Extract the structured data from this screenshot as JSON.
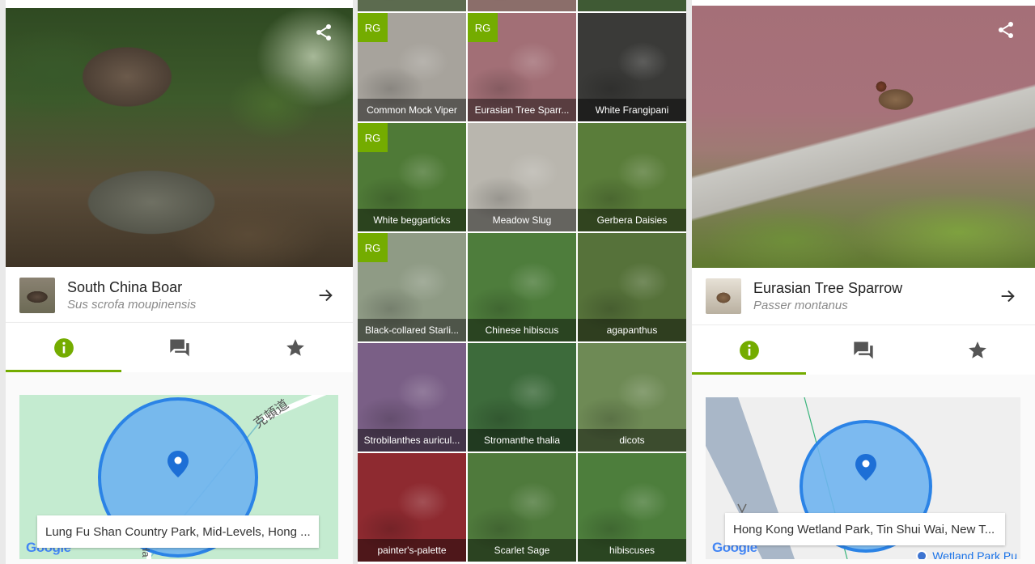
{
  "colors": {
    "accent": "#74ac00",
    "rg_badge": "#74ac00",
    "map_circle": "#6fb4f0",
    "map_circle_border": "#2b83e6"
  },
  "icons": {
    "share": "share-icon",
    "forward": "arrow-right-icon",
    "info": "info-icon",
    "comments": "comment-icon",
    "favorite": "star-icon",
    "pin": "map-pin-icon"
  },
  "left_panel": {
    "common_name": "South China Boar",
    "scientific_name": "Sus scrofa moupinensis",
    "tabs": [
      "info",
      "comments",
      "favorites"
    ],
    "active_tab": 0,
    "location": "Lung Fu Shan Country Park, Mid-Levels, Hong ...",
    "map_label_cn": "克頓道",
    "map_label_v": "Ha",
    "map_brand": "Google"
  },
  "right_panel": {
    "common_name": "Eurasian Tree Sparrow",
    "scientific_name": "Passer montanus",
    "tabs": [
      "info",
      "comments",
      "favorites"
    ],
    "active_tab": 0,
    "location": "Hong Kong Wetland Park, Tin Shui Wai, New T...",
    "map_place_label": "Wetland Park Pu",
    "map_brand": "Google"
  },
  "grid": {
    "rg_label": "RG",
    "items": [
      {
        "name": "",
        "rg": false,
        "bg": "#5c6b4f"
      },
      {
        "name": "",
        "rg": false,
        "bg": "#8b6e6a"
      },
      {
        "name": "",
        "rg": false,
        "bg": "#3f5a34"
      },
      {
        "name": "Common Mock Viper",
        "rg": true,
        "bg": "#a7a39c"
      },
      {
        "name": "Eurasian Tree Sparr...",
        "rg": true,
        "bg": "#a26f76"
      },
      {
        "name": "White Frangipani",
        "rg": false,
        "bg": "#3a3a38"
      },
      {
        "name": "White beggarticks",
        "rg": true,
        "bg": "#4f7a37"
      },
      {
        "name": "Meadow Slug",
        "rg": false,
        "bg": "#b9b6ae"
      },
      {
        "name": "Gerbera Daisies",
        "rg": false,
        "bg": "#5a7d3a"
      },
      {
        "name": "Black-collared Starli...",
        "rg": true,
        "bg": "#8f9b85"
      },
      {
        "name": "Chinese hibiscus",
        "rg": false,
        "bg": "#4e7d3c"
      },
      {
        "name": "agapanthus",
        "rg": false,
        "bg": "#56723a"
      },
      {
        "name": "Strobilanthes auricul...",
        "rg": false,
        "bg": "#7a5f86"
      },
      {
        "name": "Stromanthe thalia",
        "rg": false,
        "bg": "#3d6b3b"
      },
      {
        "name": "dicots",
        "rg": false,
        "bg": "#6e8a55"
      },
      {
        "name": "painter's-palette",
        "rg": false,
        "bg": "#8e2a30"
      },
      {
        "name": "Scarlet Sage",
        "rg": false,
        "bg": "#4f7a3c"
      },
      {
        "name": "hibiscuses",
        "rg": false,
        "bg": "#4d7e3c"
      }
    ]
  }
}
